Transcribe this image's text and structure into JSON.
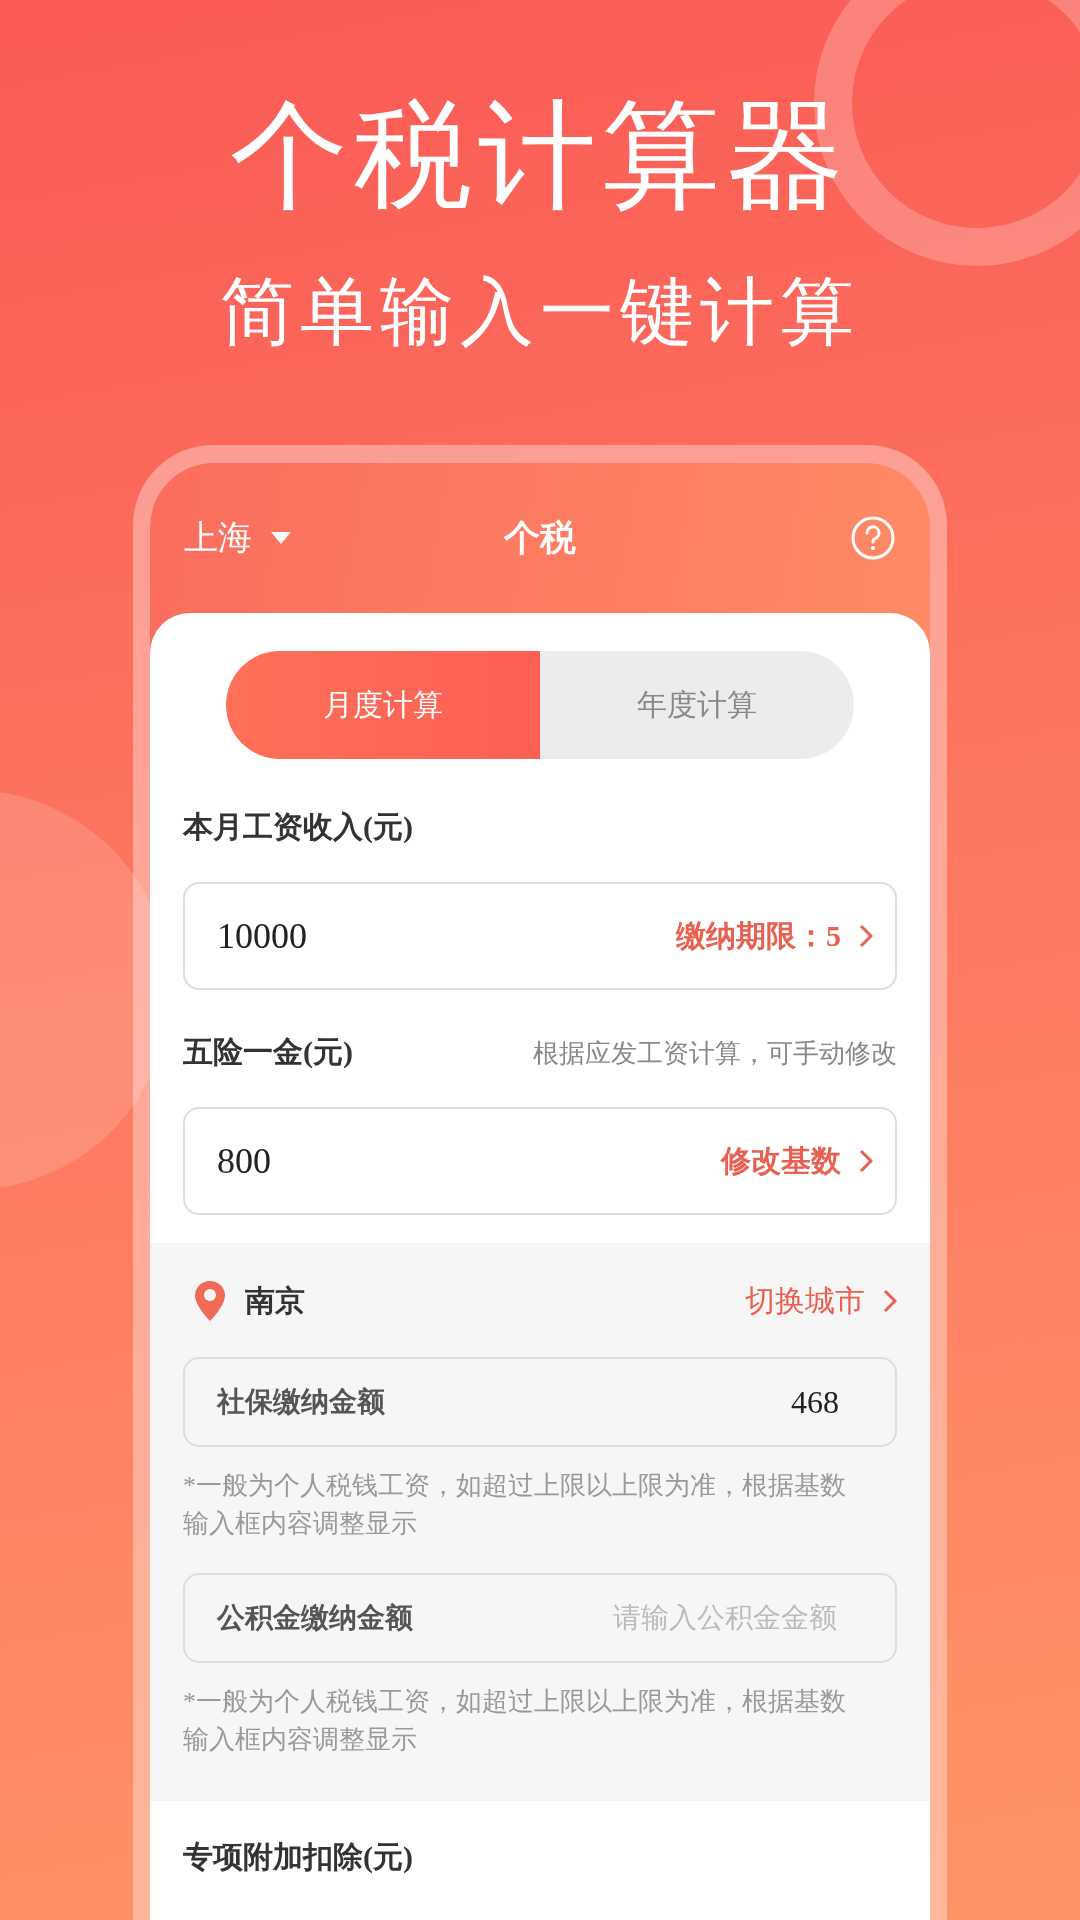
{
  "headline": "个税计算器",
  "subtitle": "简单输入一键计算",
  "app_bar": {
    "city": "上海",
    "title": "个税"
  },
  "tabs": [
    {
      "label": "月度计算",
      "selected": true
    },
    {
      "label": "年度计算",
      "selected": false
    }
  ],
  "salary": {
    "label": "本月工资收入(元)",
    "value": "10000",
    "action": "缴纳期限：5"
  },
  "insurance": {
    "label": "五险一金(元)",
    "hint": "根据应发工资计算，可手动修改",
    "value": "800",
    "action": "修改基数"
  },
  "city_section": {
    "city": "南京",
    "action": "切换城市",
    "fields": [
      {
        "label": "社保缴纳金额",
        "value": "468",
        "note": "*一般为个人税钱工资，如超过上限以上限为准，根据基数输入框内容调整显示"
      },
      {
        "label": "公积金缴纳金额",
        "placeholder": "请输入公积金金额",
        "note": "*一般为个人税钱工资，如超过上限以上限为准，根据基数输入框内容调整显示"
      }
    ]
  },
  "deduction": {
    "label": "专项附加扣除(元)"
  }
}
